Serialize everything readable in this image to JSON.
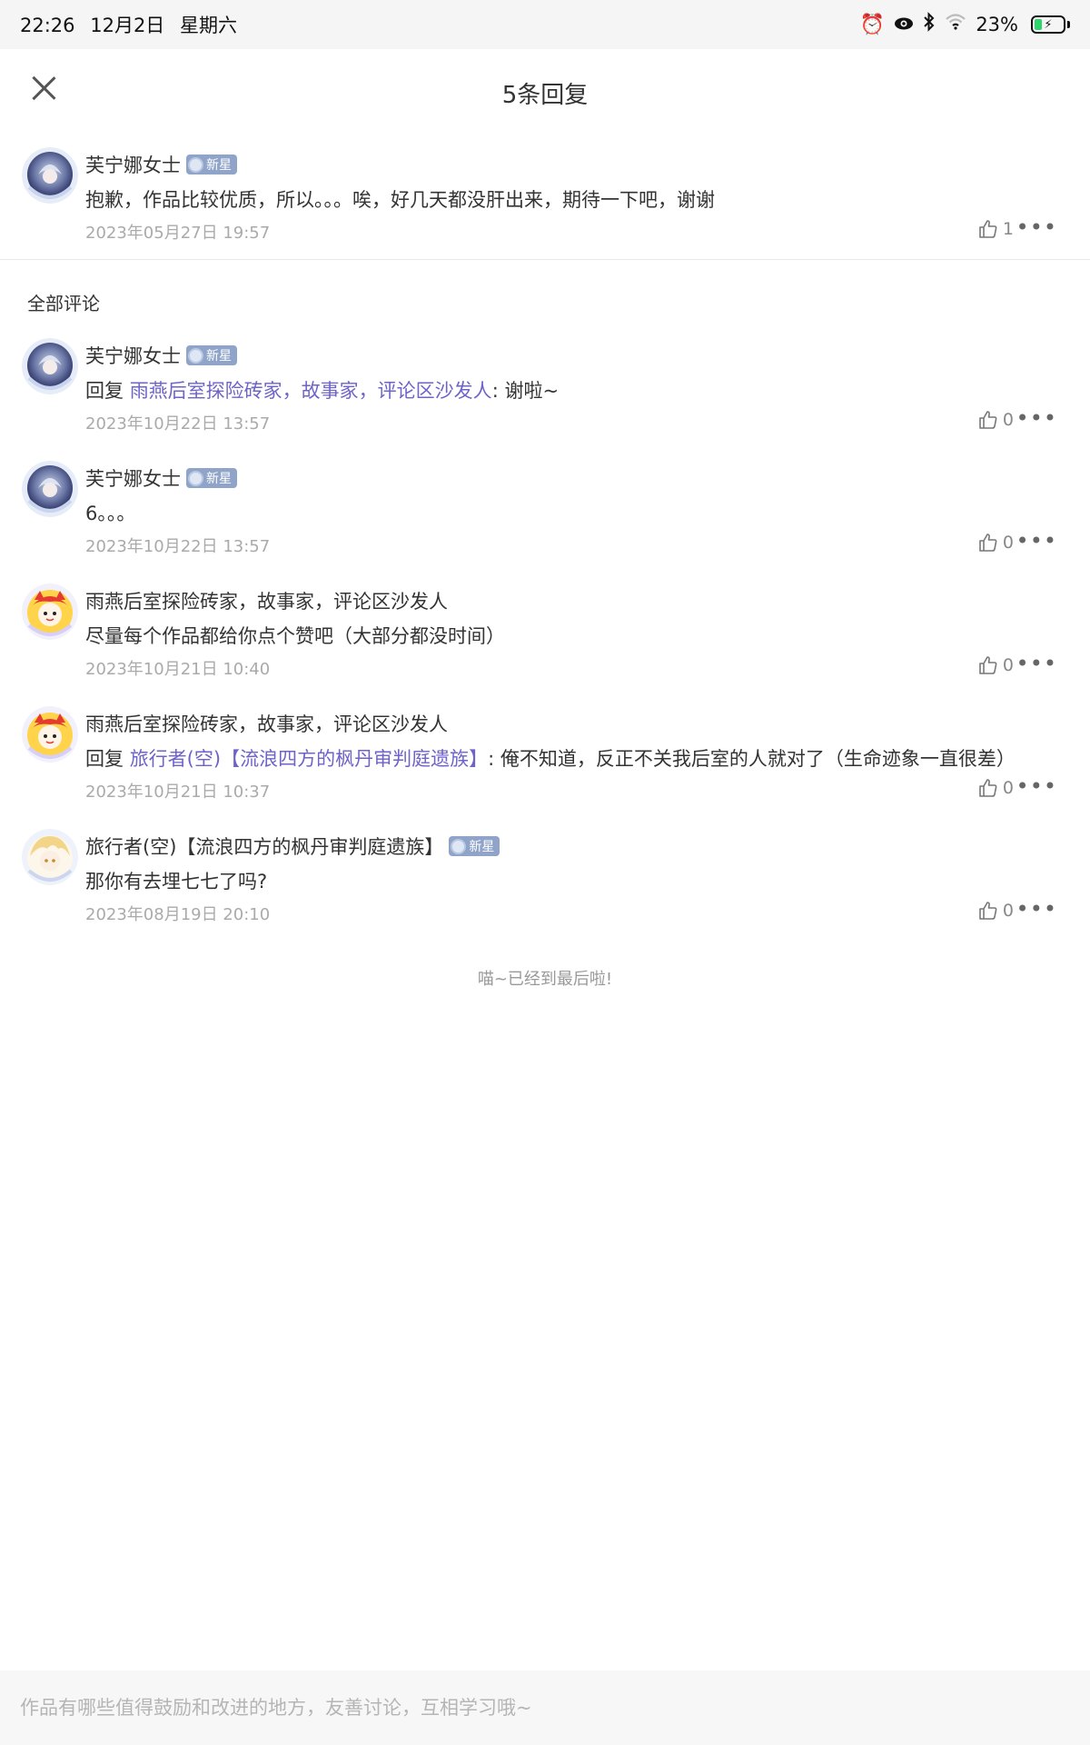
{
  "status_bar": {
    "time": "22:26",
    "date": "12月2日",
    "weekday": "星期六",
    "battery": "23%",
    "icons": [
      "alarm-icon",
      "eye-icon",
      "bluetooth-icon",
      "wifi-icon",
      "battery-icon"
    ]
  },
  "header": {
    "title": "5条回复",
    "close_icon": "close-icon"
  },
  "parent_comment": {
    "author": "芙宁娜女士",
    "badge": "新星",
    "text": "抱歉，作品比较优质，所以。。。唉，好几天都没肝出来，期待一下吧，谢谢",
    "time": "2023年05月27日 19:57",
    "likes": "1"
  },
  "section_title": "全部评论",
  "replies": [
    {
      "author": "芙宁娜女士",
      "badge": "新星",
      "reply_prefix": "回复 ",
      "reply_to": "雨燕后室探险砖家，故事家，评论区沙发人",
      "text": ": 谢啦~",
      "time": "2023年10月22日 13:57",
      "likes": "0",
      "avatar": "furina"
    },
    {
      "author": "芙宁娜女士",
      "badge": "新星",
      "text": "6。。。",
      "time": "2023年10月22日 13:57",
      "likes": "0",
      "avatar": "furina"
    },
    {
      "author": "雨燕后室探险砖家，故事家，评论区沙发人",
      "text": "尽量每个作品都给你点个赞吧（大部分都没时间）",
      "time": "2023年10月21日 10:40",
      "likes": "0",
      "avatar": "red-mascot"
    },
    {
      "author": "雨燕后室探险砖家，故事家，评论区沙发人",
      "reply_prefix": "回复 ",
      "reply_to": "旅行者(空)【流浪四方的枫丹审判庭遗族】",
      "text": ": 俺不知道，反正不关我后室的人就对了（生命迹象一直很差）",
      "time": "2023年10月21日 10:37",
      "likes": "0",
      "avatar": "red-mascot"
    },
    {
      "author": "旅行者(空)【流浪四方的枫丹审判庭遗族】",
      "badge": "新星",
      "text": "那你有去埋七七了吗?",
      "time": "2023年08月19日 20:10",
      "likes": "0",
      "avatar": "traveler"
    }
  ],
  "end_note": "喵~已经到最后啦!",
  "input": {
    "placeholder": "作品有哪些值得鼓励和改进的地方，友善讨论，互相学习哦~"
  },
  "colors": {
    "link": "#6d63c9",
    "badge": "#8fa4c8",
    "time_text": "#aaaaaa"
  }
}
